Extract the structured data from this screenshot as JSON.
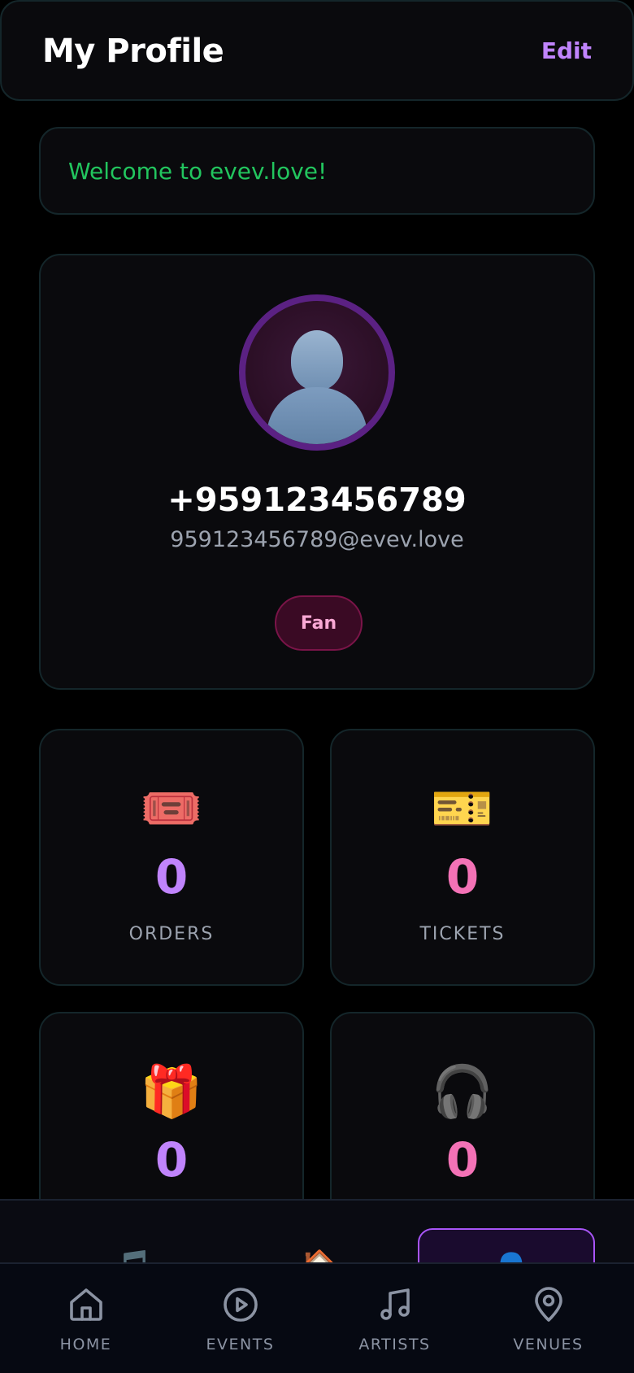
{
  "header": {
    "title": "My Profile",
    "edit_label": "Edit"
  },
  "welcome": {
    "message": "Welcome to evev.love!"
  },
  "profile": {
    "avatar_icon": "person-silhouette-icon",
    "phone": "+959123456789",
    "email": "959123456789@evev.love",
    "role": "Fan"
  },
  "stats": [
    {
      "icon": "🎟️",
      "icon_name": "admit-one-ticket-icon",
      "value": "0",
      "label": "ORDERS",
      "color": "#c084fc"
    },
    {
      "icon": "🎫",
      "icon_name": "concert-ticket-icon",
      "value": "0",
      "label": "TICKETS",
      "color": "#f472b6"
    },
    {
      "icon": "🎁",
      "icon_name": "gift-icon",
      "value": "0",
      "label": "",
      "color": "#c084fc"
    },
    {
      "icon": "🎧",
      "icon_name": "headphones-icon",
      "value": "0",
      "label": "",
      "color": "#f472b6"
    }
  ],
  "float_nav": {
    "items": [
      {
        "icon": "🎵",
        "icon_name": "music-note-icon"
      },
      {
        "icon": "🏠",
        "icon_name": "house-icon"
      },
      {
        "icon": "👤",
        "icon_name": "profile-icon",
        "active": true
      }
    ]
  },
  "tabbar": {
    "items": [
      {
        "label": "HOME",
        "icon_name": "home-icon"
      },
      {
        "label": "EVENTS",
        "icon_name": "play-circle-icon"
      },
      {
        "label": "ARTISTS",
        "icon_name": "music-note-icon"
      },
      {
        "label": "VENUES",
        "icon_name": "map-pin-icon"
      }
    ]
  },
  "colors": {
    "accent_purple": "#c084fc",
    "accent_pink": "#f472b6",
    "success_green": "#22c55e",
    "card_bg": "#0a0a0d",
    "card_border": "#14262a"
  }
}
